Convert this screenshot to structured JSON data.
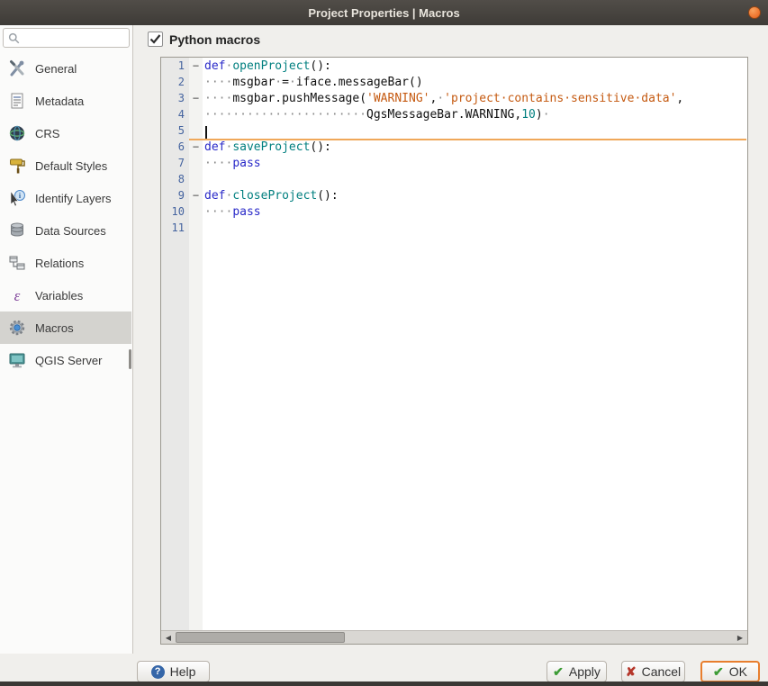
{
  "window": {
    "title": "Project Properties | Macros"
  },
  "sidebar": {
    "search": {
      "value": "",
      "placeholder": ""
    },
    "selected": "Macros",
    "items": [
      {
        "label": "General",
        "icon": "general-tools-icon"
      },
      {
        "label": "Metadata",
        "icon": "metadata-document-icon"
      },
      {
        "label": "CRS",
        "icon": "crs-globe-icon"
      },
      {
        "label": "Default Styles",
        "icon": "styles-paint-icon"
      },
      {
        "label": "Identify Layers",
        "icon": "identify-cursor-icon"
      },
      {
        "label": "Data Sources",
        "icon": "data-sources-icon"
      },
      {
        "label": "Relations",
        "icon": "relations-table-icon"
      },
      {
        "label": "Variables",
        "icon": "variables-epsilon-icon"
      },
      {
        "label": "Macros",
        "icon": "macros-gear-icon"
      },
      {
        "label": "QGIS Server",
        "icon": "server-monitor-icon"
      }
    ]
  },
  "panel": {
    "checkbox_label": "Python macros",
    "checkbox_checked": true
  },
  "editor": {
    "current_line": 5,
    "fold_marker": "−",
    "margin_number_color": "#44639f",
    "caret_line_color": "#f0a85a",
    "token_colors": {
      "kw": "#2929c8",
      "fn": "#007f7f",
      "str": "#c55a11",
      "num": "#007f7f",
      "pl": "#111111",
      "ws": "#8a8a8a"
    },
    "lines": [
      {
        "n": "1",
        "fold": true,
        "tokens": [
          {
            "t": "def",
            "c": "kw"
          },
          {
            "t": "·",
            "c": "ws"
          },
          {
            "t": "openProject",
            "c": "fn"
          },
          {
            "t": "():",
            "c": "pl"
          }
        ]
      },
      {
        "n": "2",
        "fold": false,
        "tokens": [
          {
            "t": "····",
            "c": "ws"
          },
          {
            "t": "msgbar",
            "c": "pl"
          },
          {
            "t": "·",
            "c": "ws"
          },
          {
            "t": "=",
            "c": "pl"
          },
          {
            "t": "·",
            "c": "ws"
          },
          {
            "t": "iface.messageBar()",
            "c": "pl"
          }
        ]
      },
      {
        "n": "3",
        "fold": true,
        "tokens": [
          {
            "t": "····",
            "c": "ws"
          },
          {
            "t": "msgbar.pushMessage(",
            "c": "pl"
          },
          {
            "t": "'WARNING'",
            "c": "str"
          },
          {
            "t": ",",
            "c": "pl"
          },
          {
            "t": "·",
            "c": "ws"
          },
          {
            "t": "'project·contains·sensitive·data'",
            "c": "str"
          },
          {
            "t": ",",
            "c": "pl"
          }
        ]
      },
      {
        "n": "4",
        "fold": false,
        "tokens": [
          {
            "t": "·······················",
            "c": "ws"
          },
          {
            "t": "QgsMessageBar.WARNING,",
            "c": "pl"
          },
          {
            "t": "10",
            "c": "num"
          },
          {
            "t": ")",
            "c": "pl"
          },
          {
            "t": "·",
            "c": "ws"
          }
        ]
      },
      {
        "n": "5",
        "fold": false,
        "tokens": []
      },
      {
        "n": "6",
        "fold": true,
        "tokens": [
          {
            "t": "def",
            "c": "kw"
          },
          {
            "t": "·",
            "c": "ws"
          },
          {
            "t": "saveProject",
            "c": "fn"
          },
          {
            "t": "():",
            "c": "pl"
          }
        ]
      },
      {
        "n": "7",
        "fold": false,
        "tokens": [
          {
            "t": "····",
            "c": "ws"
          },
          {
            "t": "pass",
            "c": "kw"
          }
        ]
      },
      {
        "n": "8",
        "fold": false,
        "tokens": []
      },
      {
        "n": "9",
        "fold": true,
        "tokens": [
          {
            "t": "def",
            "c": "kw"
          },
          {
            "t": "·",
            "c": "ws"
          },
          {
            "t": "closeProject",
            "c": "fn"
          },
          {
            "t": "():",
            "c": "pl"
          }
        ]
      },
      {
        "n": "10",
        "fold": false,
        "tokens": [
          {
            "t": "····",
            "c": "ws"
          },
          {
            "t": "pass",
            "c": "kw"
          }
        ]
      },
      {
        "n": "11",
        "fold": false,
        "tokens": []
      }
    ]
  },
  "buttons": {
    "help": "Help",
    "apply": "Apply",
    "cancel": "Cancel",
    "ok": "OK"
  }
}
